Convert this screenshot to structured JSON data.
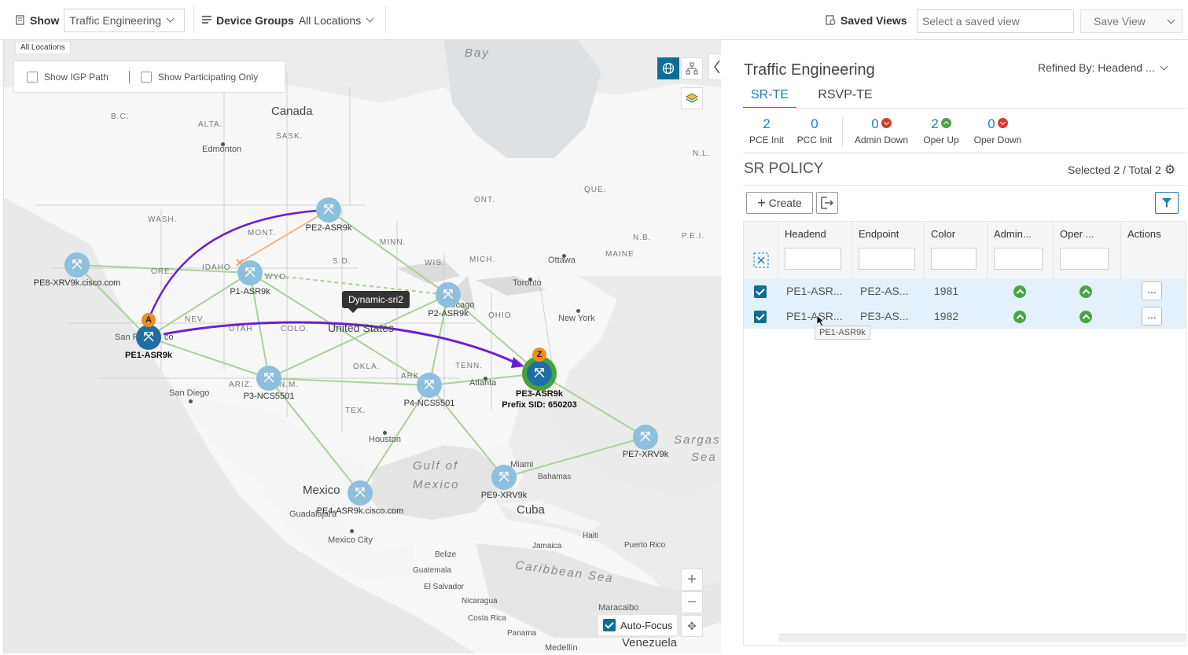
{
  "topbar": {
    "show_label": "Show",
    "show_value": "Traffic Engineering",
    "device_groups_label": "Device Groups",
    "device_groups_value": "All Locations",
    "saved_views_label": "Saved Views",
    "saved_view_placeholder": "Select a saved view",
    "save_view_label": "Save View"
  },
  "map": {
    "location_label": "All Locations",
    "show_igp_path": "Show IGP Path",
    "show_participating_only": "Show Participating Only",
    "auto_focus_label": "Auto-Focus",
    "tooltip": "Dynamic-sri2",
    "geo_labels": {
      "bay": "Bay",
      "canada": "Canada",
      "bc": "B.C.",
      "alta": "ALTA.",
      "sask": "SASK.",
      "edmonton": "Edmonton",
      "que": "QUE.",
      "ont": "ONT.",
      "nl": "N.L.",
      "nb": "N.B.",
      "pei": "P.E.I.",
      "maine": "MAINE",
      "wash": "WASH.",
      "mont": "MONT.",
      "ore": "ORE.",
      "idaho": "IDAHO",
      "wyo": "WYO.",
      "sd": "S.D.",
      "minn": "MINN.",
      "wis": "WIS.",
      "mich": "MICH.",
      "ottawa": "Ottawa",
      "toronto": "Toronto",
      "chicago": "Chicago",
      "ohio": "OHIO",
      "new_york": "New York",
      "nev": "NEV.",
      "utah": "UTAH",
      "colo": "COLO.",
      "united_states": "United States",
      "san_fr": "San F",
      "co": "co",
      "ariz": "ARIZ.",
      "nm": "N.M.",
      "okla": "OKLA.",
      "ark": "ARK.",
      "tenn": "TENN.",
      "atlanta": "Atlanta",
      "tex": "TEX.",
      "san_diego": "San Diego",
      "houston": "Houston",
      "gulf_of": "Gulf of",
      "mexico_gulf": "Mexico",
      "mexico": "Mexico",
      "guadalajara": "Guadalajara",
      "mexico_city": "Mexico City",
      "miami": "Miami",
      "bahamas": "Bahamas",
      "cuba": "Cuba",
      "haiti": "Haiti",
      "puerto_rico": "Puerto Rico",
      "jamaica": "Jamaica",
      "belize": "Belize",
      "guatemala": "Guatemala",
      "el_salvador": "El Salvador",
      "nicaragua": "Nicaragua",
      "costa_rica": "Costa Rica",
      "panama": "Panama",
      "caribbean_sea": "Caribbean Sea",
      "sargasso": "Sargas",
      "sea": "Sea",
      "maracaibo": "Maracaibo",
      "medellin": "Medellín",
      "venezuela": "Venezuela"
    },
    "nodes": [
      {
        "id": "pe1",
        "label": "PE1-ASR9k"
      },
      {
        "id": "pe2",
        "label": "PE2-ASR9k"
      },
      {
        "id": "pe3",
        "label": "PE3-ASR9k",
        "sublabel": "Prefix SID: 650203"
      },
      {
        "id": "pe4",
        "label": "PE4-ASR9k.cisco.com"
      },
      {
        "id": "pe7",
        "label": "PE7-XRV9k"
      },
      {
        "id": "pe8",
        "label": "PE8-XRV9k.cisco.com"
      },
      {
        "id": "pe9",
        "label": "PE9-XRV9k"
      },
      {
        "id": "p1",
        "label": "P1-ASR9k"
      },
      {
        "id": "p2",
        "label": "P2-ASR9k"
      },
      {
        "id": "p3",
        "label": "P3-NCS5501"
      },
      {
        "id": "p4",
        "label": "P4-NCS5501"
      }
    ],
    "pin_a": "A",
    "pin_z": "Z"
  },
  "panel": {
    "title": "Traffic Engineering",
    "refined_by": "Refined By: Headend ...",
    "tabs": [
      "SR-TE",
      "RSVP-TE"
    ],
    "stats": [
      {
        "value": "2",
        "label": "PCE Init"
      },
      {
        "value": "0",
        "label": "PCC Init"
      },
      {
        "value": "0",
        "label": "Admin Down"
      },
      {
        "value": "2",
        "label": "Oper Up"
      },
      {
        "value": "0",
        "label": "Oper Down"
      }
    ],
    "section_title": "SR POLICY",
    "selection": "Selected 2 / Total 2",
    "create_label": "Create",
    "columns": [
      "Headend",
      "Endpoint",
      "Color",
      "Admin...",
      "Oper ...",
      "Actions"
    ],
    "rows": [
      {
        "headend": "PE1-ASR...",
        "endpoint": "PE2-AS...",
        "color": "1981",
        "actions": "..."
      },
      {
        "headend": "PE1-ASR...",
        "endpoint": "PE3-AS...",
        "color": "1982",
        "actions": "..."
      }
    ],
    "hover_tooltip": "PE1-ASR9k"
  }
}
